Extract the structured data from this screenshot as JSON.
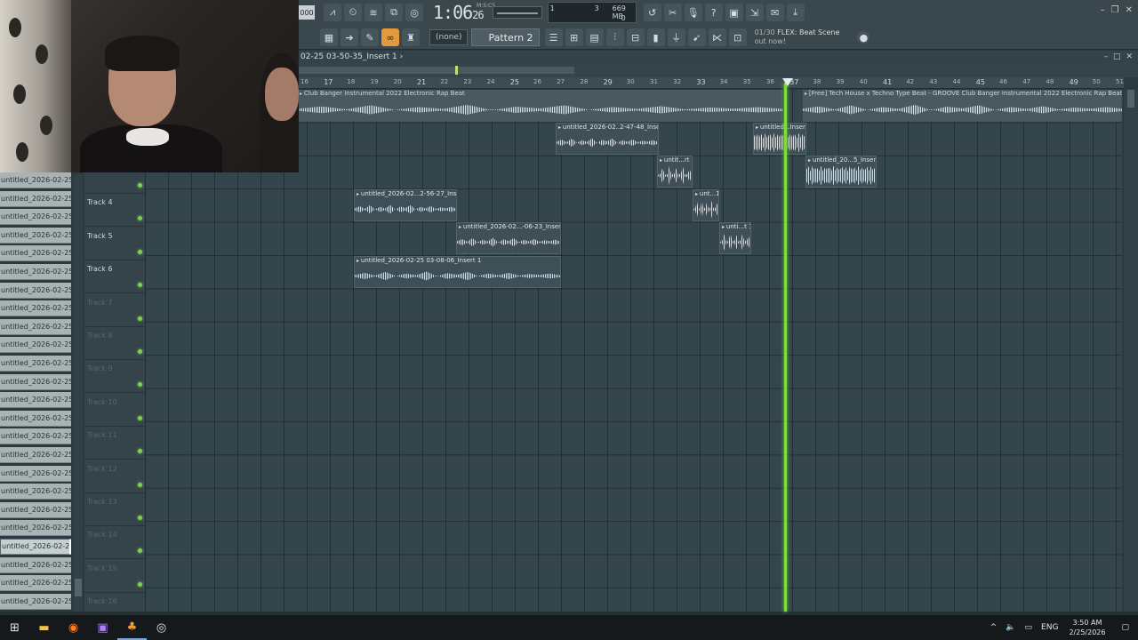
{
  "toolbar": {
    "tempo": "000",
    "time_main": "1:06",
    "time_sub": "26",
    "time_unit": "M:S:CS",
    "cpu_value": "3",
    "ram_value": "669 MB",
    "cpu_zero": "0",
    "cpu_voice": "1",
    "pattern_none": "(none)",
    "pattern_name": "Pattern 2",
    "hint_count": "01/30",
    "hint_title": "FLEX: Beat Scene",
    "hint_sub": "out now!"
  },
  "playlist": {
    "title": "02-25 03-50-35_Insert 1 ›",
    "ruler_ticks": [
      "16",
      "17",
      "18",
      "19",
      "20",
      "21",
      "22",
      "23",
      "24",
      "25",
      "26",
      "27",
      "28",
      "29",
      "30",
      "31",
      "32",
      "33",
      "34",
      "35",
      "36",
      "37",
      "38",
      "39",
      "40",
      "41",
      "42",
      "43",
      "44",
      "45",
      "46",
      "47",
      "48",
      "49",
      "50",
      "51"
    ],
    "top_clip_a": "Club Banger Instrumental 2022  Electronic Rap Beat",
    "top_clip_b": "[Free] Tech House x Techno Type Beat - GROOVE  Club Banger Instrumental 2022  Electronic Rap Beat"
  },
  "clips": [
    {
      "name": "untitled_2026-02..2-47-48_Insert 1"
    },
    {
      "name": "untitled...Insert 1"
    },
    {
      "name": "untit...rt 1"
    },
    {
      "name": "untitled_20...5_Insert 1"
    },
    {
      "name": "untitled_2026-02...2-56-27_Insert 1"
    },
    {
      "name": "unt...1"
    },
    {
      "name": "untitled_2026-02...-06-23_Insert 1"
    },
    {
      "name": "unti...t 1"
    },
    {
      "name": "untitled_2026-02-25 03-08-06_Insert 1"
    }
  ],
  "track_list": [
    "untitled_2026-02-25 03-...",
    "untitled_2026-02-25 03-...",
    "untitled_2026-02-25 03-...",
    "untitled_2026-02-25 03-...",
    "untitled_2026-02-25 03-...",
    "untitled_2026-02-25 03-...",
    "untitled_2026-02-25 03-...",
    "untitled_2026-02-25 03-...",
    "untitled_2026-02-25 03-...",
    "untitled_2026-02-25 03-...",
    "untitled_2026-02-25 03-...",
    "untitled_2026-02-25 03-...",
    "untitled_2026-02-25 03-...",
    "untitled_2026-02-25 03-...",
    "untitled_2026-02-25 03-...",
    "untitled_2026-02-25 03-...",
    "untitled_2026-02-25 03-...",
    "untitled_2026-02-25 03-...",
    "untitled_2026-02-25 03-...",
    "untitled_2026-02-25 03-...",
    "untitled_2026-02-25 03-...",
    "untitled_2026-02-25 03-...",
    "untitled_2026-02-25 03-...",
    "untitled_2026-02-25 03-..."
  ],
  "tracks": [
    "",
    "Track 4",
    "Track 5",
    "Track 6",
    "Track 7",
    "Track 8",
    "Track 9",
    "Track 10",
    "Track 11",
    "Track 12",
    "Track 13",
    "Track 14",
    "Track 15",
    "Track 16"
  ],
  "taskbar": {
    "lang": "ENG",
    "time": "3:50 AM",
    "date": "2/25/2026"
  },
  "colors": {
    "playhead": "#7be03d",
    "accent": "#e39a3f"
  }
}
